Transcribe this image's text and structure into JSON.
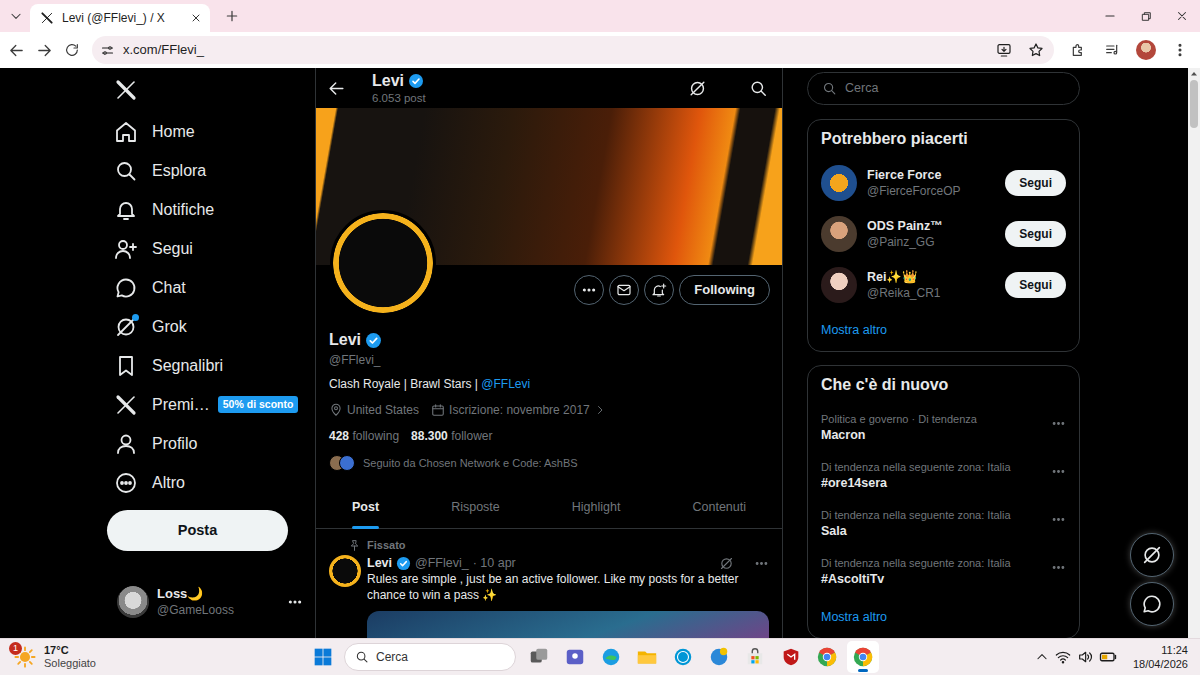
{
  "browser": {
    "tab_title": "Levi (@FFlevi_) / X",
    "address": "x.com/FFlevi_"
  },
  "nav": {
    "items": [
      {
        "label": "Home",
        "dot": false
      },
      {
        "label": "Esplora",
        "dot": false
      },
      {
        "label": "Notifiche",
        "dot": false
      },
      {
        "label": "Segui",
        "dot": false
      },
      {
        "label": "Chat",
        "dot": false
      },
      {
        "label": "Grok",
        "dot": true
      },
      {
        "label": "Segnalibri",
        "dot": false
      },
      {
        "label": "Premi…",
        "dot": false,
        "badge": "50% di sconto"
      },
      {
        "label": "Profilo",
        "dot": false
      },
      {
        "label": "Altro",
        "dot": false
      }
    ],
    "post_button": "Posta",
    "account": {
      "name": "Loss🌙",
      "handle": "@GameLooss"
    }
  },
  "profile": {
    "header_name": "Levi",
    "post_count": "6.053 post",
    "verified": true,
    "follow_button": "Following",
    "name": "Levi",
    "handle": "@FFlevi_",
    "bio": "Clash Royale | Brawl Stars | ",
    "bio_link": "@FFLevi",
    "location": "United States",
    "joined": "Iscrizione: novembre 2017",
    "following_count": "428",
    "following_label": "following",
    "followers_count": "88.300",
    "followers_label": "follower",
    "followed_by": "Seguito da Chosen Network e Code: AshBS"
  },
  "tabs": [
    {
      "label": "Post",
      "selected": true
    },
    {
      "label": "Risposte",
      "selected": false
    },
    {
      "label": "Highlight",
      "selected": false
    },
    {
      "label": "Contenuti",
      "selected": false
    }
  ],
  "pinned_post": {
    "pinned_label": "Fissato",
    "name": "Levi",
    "verified": true,
    "handle": "@FFlevi_",
    "time": "· 10 apr",
    "text": "Rules are simple , just be an active follower. Like my posts for a better chance to win a pass ✨"
  },
  "sidebar": {
    "search": {
      "placeholder": "Cerca"
    },
    "who_to_follow": {
      "title": "Potrebbero piacerti",
      "users": [
        {
          "name": "Fierce Force",
          "handle": "@FierceForceOP",
          "button": "Segui"
        },
        {
          "name": "ODS Painz™",
          "handle": "@Painz_GG",
          "button": "Segui"
        },
        {
          "name": "Rei✨👑",
          "handle": "@Reika_CR1",
          "button": "Segui"
        }
      ],
      "more": "Mostra altro"
    },
    "trends": {
      "title": "Che c'è di nuovo",
      "items": [
        {
          "context": "Politica e governo · Di tendenza",
          "topic": "Macron"
        },
        {
          "context": "Di tendenza nella seguente zona: Italia",
          "topic": "#ore14sera"
        },
        {
          "context": "Di tendenza nella seguente zona: Italia",
          "topic": "Sala"
        },
        {
          "context": "Di tendenza nella seguente zona: Italia",
          "topic": "#AscoltiTv"
        }
      ],
      "more": "Mostra altro"
    }
  },
  "taskbar": {
    "weather": {
      "temperature": "17°C",
      "condition": "Soleggiato",
      "badge": "1"
    },
    "search": {
      "placeholder": "Cerca"
    },
    "apps": [
      {
        "selected": false
      },
      {
        "selected": false
      },
      {
        "selected": false
      },
      {
        "selected": false
      },
      {
        "selected": false
      },
      {
        "selected": false
      },
      {
        "selected": false
      },
      {
        "selected": false
      },
      {
        "selected": false
      },
      {
        "selected": true
      }
    ],
    "time": "11:24",
    "date": "18/04/2026"
  }
}
